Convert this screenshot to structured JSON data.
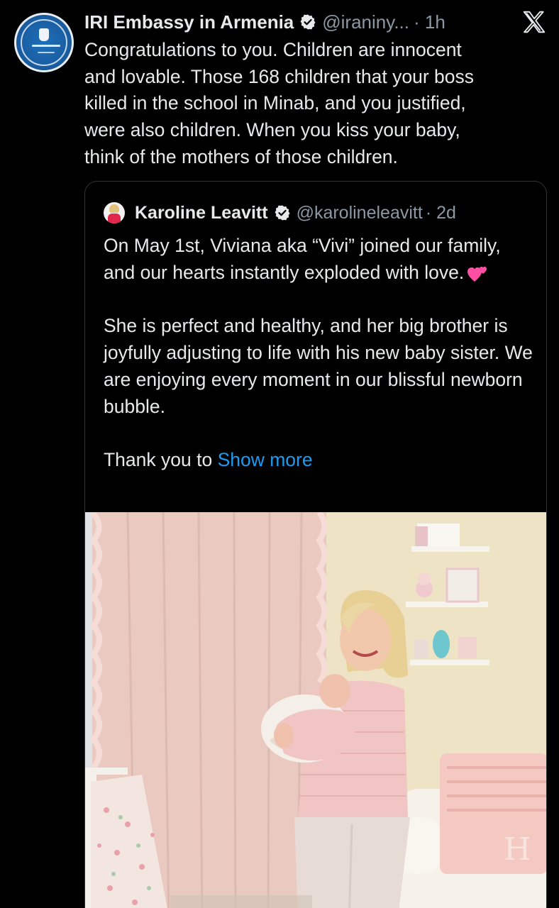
{
  "tweet": {
    "author_name": "IRI Embassy in Armenia",
    "handle": "@iraniny...",
    "time": "· 1h",
    "text": "Congratulations to you. Children are innocent\nand lovable. Those 168 children that your boss\nkilled in the school in Minab, and you justified,\nwere also children. When you kiss your baby,\nthink of the mothers of those children."
  },
  "quote": {
    "author_name": "Karoline Leavitt",
    "handle": "@karolineleavitt",
    "time": "· 2d",
    "paragraph1": "On May 1st, Viviana aka “Vivi” joined our family, and our hearts instantly exploded with love.",
    "paragraph2": "She is perfect and healthy, and her big brother is joyfully adjusting to life with his new baby sister. We are enjoying every moment in our blissful newborn bubble.",
    "paragraph3": "Thank you to",
    "show_more": "Show more"
  },
  "icons": {
    "verified": "verified-badge-icon",
    "x_logo": "x-logo-icon",
    "hearts": "two-hearts-emoji"
  },
  "colors": {
    "background": "#000000",
    "text": "#e7e9ea",
    "muted": "#8b98a5",
    "link": "#1d9bf0",
    "border": "#2f3336"
  }
}
